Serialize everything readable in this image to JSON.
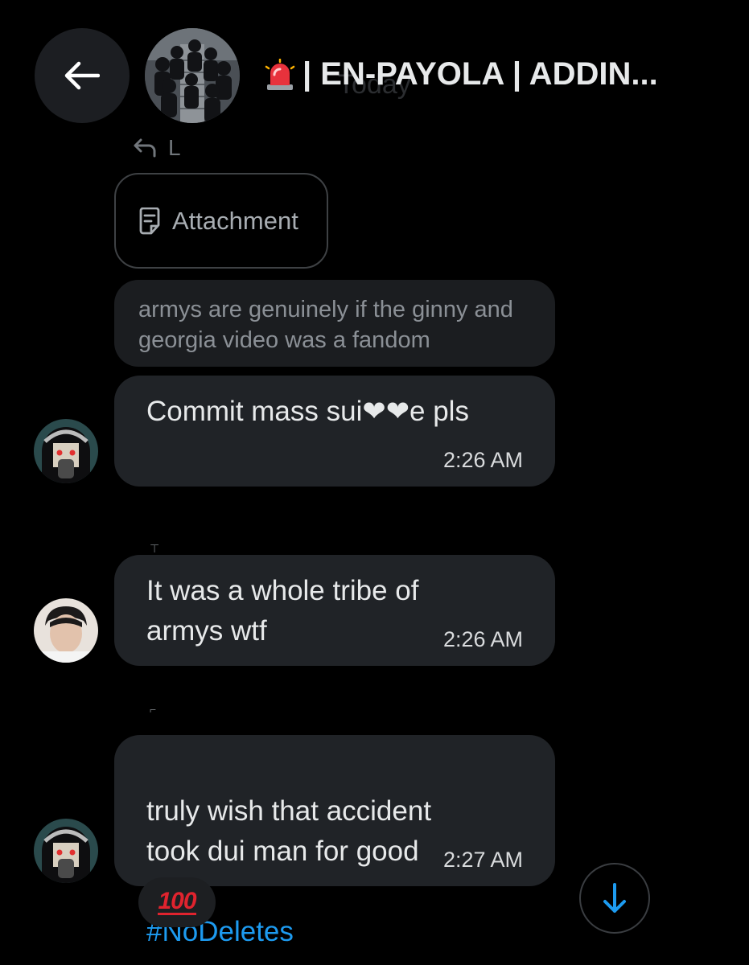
{
  "header": {
    "title": "| EN-PAYOLA | ADDIN...",
    "background_date": "Today"
  },
  "reply": {
    "label": "L"
  },
  "attachment": {
    "label": "Attachment"
  },
  "quoted_message": {
    "text": "armys are genuinely if the ginny and georgia video was a fandom"
  },
  "messages": [
    {
      "text": "Commit mass sui❤❤e pls",
      "time": "2:26 AM"
    },
    {
      "text": "It was a whole tribe of\narmys wtf",
      "time": "2:26 AM"
    },
    {
      "text": "truly wish that accident\ntook dui man for good",
      "hashtag": "#NoDeletes",
      "time": "2:27 AM"
    }
  ],
  "reaction": {
    "emoji_text": "100"
  },
  "colors": {
    "background": "#000000",
    "bubble": "#202327",
    "accent": "#1d9bf0",
    "reaction_red": "#e0232e"
  },
  "icons": {
    "back": "arrow-left-icon",
    "reply": "reply-arrow-icon",
    "attachment": "document-icon",
    "scroll": "arrow-down-icon",
    "siren": "siren-emoji-icon"
  }
}
